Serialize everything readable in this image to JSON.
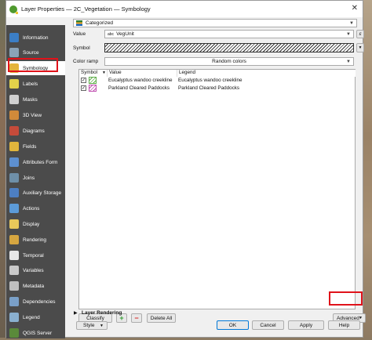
{
  "window": {
    "title": "Layer Properties — 2C_Vegetation — Symbology",
    "close_glyph": "✕"
  },
  "sidebar": {
    "items": [
      {
        "label": "Information",
        "icon": "info-icon",
        "color": "#3b7ec6"
      },
      {
        "label": "Source",
        "icon": "source-icon",
        "color": "#8aa3b8"
      },
      {
        "label": "Symbology",
        "icon": "paintbrush-icon",
        "color": "#e4b43a",
        "selected": true
      },
      {
        "label": "Labels",
        "icon": "labels-icon",
        "color": "#e2d24a"
      },
      {
        "label": "Masks",
        "icon": "masks-icon",
        "color": "#d0d0d0"
      },
      {
        "label": "3D View",
        "icon": "cube-icon",
        "color": "#d08a3a"
      },
      {
        "label": "Diagrams",
        "icon": "diagram-icon",
        "color": "#c54b3a"
      },
      {
        "label": "Fields",
        "icon": "fields-icon",
        "color": "#e1b53c"
      },
      {
        "label": "Attributes Form",
        "icon": "form-icon",
        "color": "#5d8fcf"
      },
      {
        "label": "Joins",
        "icon": "joins-icon",
        "color": "#6e8fa8"
      },
      {
        "label": "Auxiliary Storage",
        "icon": "storage-icon",
        "color": "#4d7fc2"
      },
      {
        "label": "Actions",
        "icon": "actions-icon",
        "color": "#5c9bd8"
      },
      {
        "label": "Display",
        "icon": "display-icon",
        "color": "#e8c85a"
      },
      {
        "label": "Rendering",
        "icon": "rendering-icon",
        "color": "#d6a640"
      },
      {
        "label": "Temporal",
        "icon": "clock-icon",
        "color": "#e6e6e6"
      },
      {
        "label": "Variables",
        "icon": "variables-icon",
        "color": "#c9c9c9"
      },
      {
        "label": "Metadata",
        "icon": "metadata-icon",
        "color": "#c0c0c0"
      },
      {
        "label": "Dependencies",
        "icon": "dependencies-icon",
        "color": "#7aa0c8"
      },
      {
        "label": "Legend",
        "icon": "legend-icon",
        "color": "#8ab0d0"
      },
      {
        "label": "QGIS Server",
        "icon": "server-icon",
        "color": "#5a8a3a"
      }
    ]
  },
  "renderer": {
    "value": "Categorized"
  },
  "value_field": {
    "label": "Value",
    "type_tag": "abc",
    "value": "VegUnit",
    "expr_glyph": "ε"
  },
  "symbol": {
    "label": "Symbol"
  },
  "color_ramp": {
    "label": "Color ramp",
    "value": "Random colors"
  },
  "table": {
    "headers": [
      "Symbol",
      "Value",
      "Legend"
    ],
    "rows": [
      {
        "checked": true,
        "value": "Eucalyptus wandoo creekline",
        "legend": "Eucalyptus wandoo creekline",
        "color": "#5fae4a"
      },
      {
        "checked": true,
        "value": "Parkland Cleared Paddocks",
        "legend": "Parkland Cleared Paddocks",
        "color": "#c04fb0"
      }
    ]
  },
  "buttons": {
    "classify": "Classify",
    "add": "+",
    "remove": "−",
    "delete_all": "Delete All",
    "advanced": "Advanced",
    "style": "Style",
    "ok": "OK",
    "cancel": "Cancel",
    "apply": "Apply",
    "help": "Help"
  },
  "layer_rendering": {
    "label": "Layer Rendering",
    "arrow": "▶"
  },
  "colors": {
    "highlight": "#e0121a"
  }
}
